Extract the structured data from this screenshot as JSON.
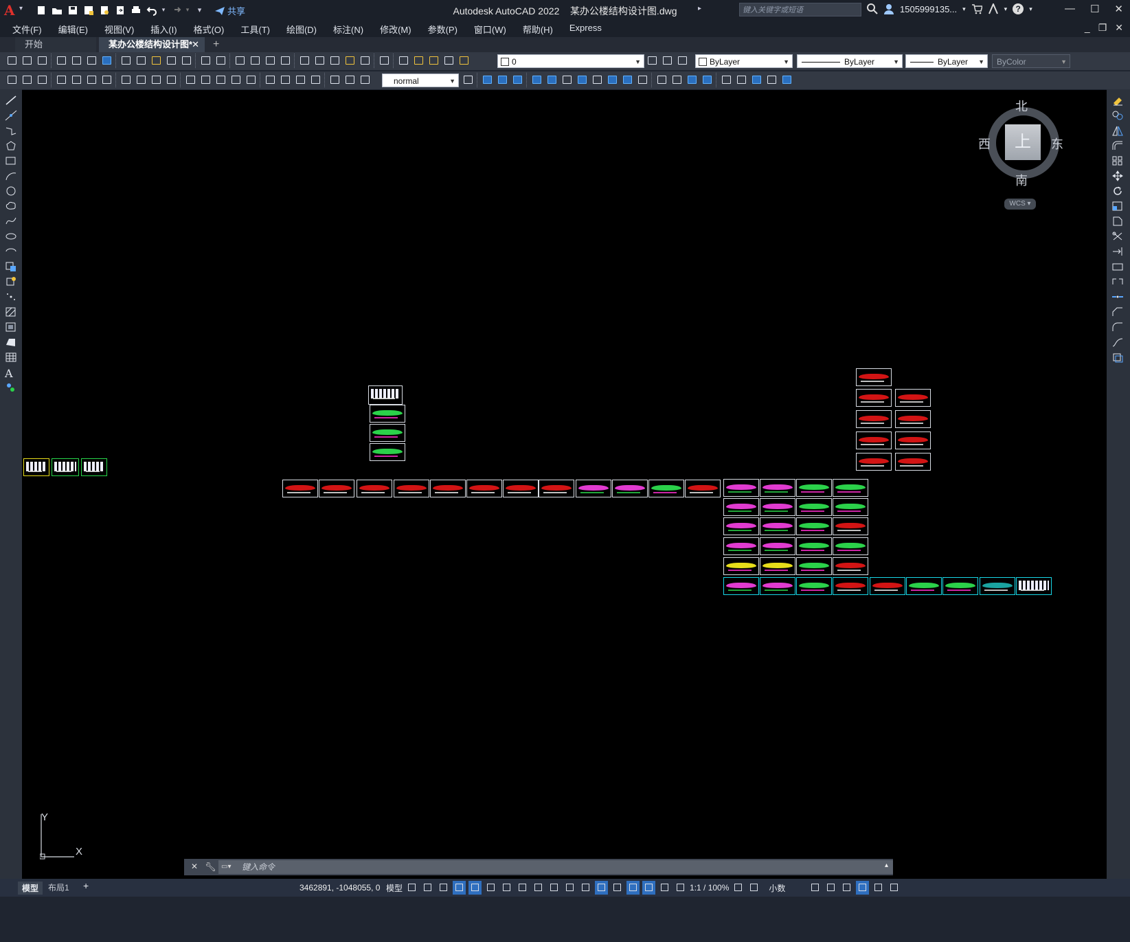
{
  "window": {
    "app_title": "Autodesk AutoCAD 2022",
    "doc_title": "某办公楼结构设计图.dwg",
    "search_placeholder": "键入关键字或短语",
    "user": "1505999135...",
    "share_label": "共享",
    "help": "?"
  },
  "menu": [
    "文件(F)",
    "编辑(E)",
    "视图(V)",
    "插入(I)",
    "格式(O)",
    "工具(T)",
    "绘图(D)",
    "标注(N)",
    "修改(M)",
    "参数(P)",
    "窗口(W)",
    "帮助(H)",
    "Express"
  ],
  "tabs": {
    "start": "开始",
    "active": "某办公楼结构设计图*",
    "close": "✕",
    "add": "+"
  },
  "toolbar": {
    "layer_value": "0",
    "color_value": "ByLayer",
    "linetype_value": "ByLayer",
    "lineweight_value": "ByLayer",
    "plotstyle_value": "ByColor",
    "textstyle_value": "normal"
  },
  "viewcube": {
    "north": "北",
    "south": "南",
    "east": "东",
    "west": "西",
    "face": "上",
    "wcs": "WCS"
  },
  "ucs": {
    "x": "X",
    "y": "Y"
  },
  "command": {
    "placeholder": "键入命令"
  },
  "status": {
    "model_tab": "模型",
    "layout_tab": "布局1",
    "add": "+",
    "coordinates": "3462891, -1048055, 0",
    "model_label": "模型",
    "scale": "1:1 / 100%",
    "units": "小数"
  }
}
